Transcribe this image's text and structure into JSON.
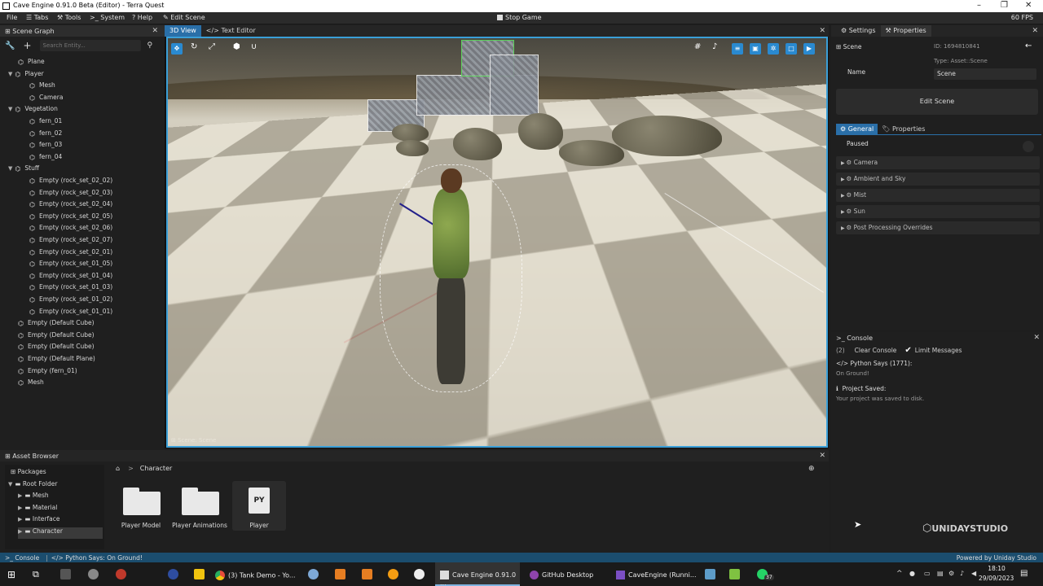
{
  "window": {
    "title": "Cave Engine 0.91.0 Beta (Editor) - Terra Quest",
    "controls": [
      "minimize-icon",
      "maximize-icon",
      "close-icon"
    ]
  },
  "menubar": {
    "items": [
      "File",
      "Tabs",
      "Tools",
      "System",
      "Help"
    ],
    "edit_scene": "Edit Scene",
    "stop_game": "Stop Game",
    "fps": "60 FPS"
  },
  "scene_graph": {
    "title": "Scene Graph",
    "search_placeholder": "Search Entity...",
    "items": [
      {
        "label": "Plane",
        "depth": 1
      },
      {
        "label": "Player",
        "depth": 0
      },
      {
        "label": "Mesh",
        "depth": 2
      },
      {
        "label": "Camera",
        "depth": 2
      },
      {
        "label": "Vegetation",
        "depth": 0
      },
      {
        "label": "fern_01",
        "depth": 2
      },
      {
        "label": "fern_02",
        "depth": 2
      },
      {
        "label": "fern_03",
        "depth": 2
      },
      {
        "label": "fern_04",
        "depth": 2
      },
      {
        "label": "Stuff",
        "depth": 0
      },
      {
        "label": "Empty (rock_set_02_02)",
        "depth": 2
      },
      {
        "label": "Empty (rock_set_02_03)",
        "depth": 2
      },
      {
        "label": "Empty (rock_set_02_04)",
        "depth": 2
      },
      {
        "label": "Empty (rock_set_02_05)",
        "depth": 2
      },
      {
        "label": "Empty (rock_set_02_06)",
        "depth": 2
      },
      {
        "label": "Empty (rock_set_02_07)",
        "depth": 2
      },
      {
        "label": "Empty (rock_set_02_01)",
        "depth": 2
      },
      {
        "label": "Empty (rock_set_01_05)",
        "depth": 2
      },
      {
        "label": "Empty (rock_set_01_04)",
        "depth": 2
      },
      {
        "label": "Empty (rock_set_01_03)",
        "depth": 2
      },
      {
        "label": "Empty (rock_set_01_02)",
        "depth": 2
      },
      {
        "label": "Empty (rock_set_01_01)",
        "depth": 2
      },
      {
        "label": "Empty (Default Cube)",
        "depth": 1
      },
      {
        "label": "Empty (Default Cube)",
        "depth": 1
      },
      {
        "label": "Empty (Default Cube)",
        "depth": 1
      },
      {
        "label": "Empty (Default Plane)",
        "depth": 1
      },
      {
        "label": "Empty (fern_01)",
        "depth": 1
      },
      {
        "label": "Mesh",
        "depth": 1
      }
    ]
  },
  "viewport": {
    "tabs": [
      "3D View",
      "Text Editor"
    ],
    "status": "Scene: Scene"
  },
  "properties": {
    "tabs": [
      "Settings",
      "Properties"
    ],
    "entity_label": "Scene",
    "id": "ID: 1694810841",
    "type": "Type: Asset::Scene",
    "name_label": "Name",
    "name_value": "Scene",
    "edit_button": "Edit Scene",
    "subtabs": [
      "General",
      "Properties"
    ],
    "paused_label": "Paused",
    "sections": [
      "Camera",
      "Ambient and Sky",
      "Mist",
      "Sun",
      "Post Processing Overrides"
    ]
  },
  "console": {
    "title": "Console",
    "count": "(2)",
    "clear": "Clear Console",
    "limit": "Limit Messages",
    "messages": [
      {
        "title": "Python Says (1771):",
        "body": "On Ground!"
      },
      {
        "title": "Project Saved:",
        "body": "Your project was saved to disk."
      }
    ]
  },
  "asset_browser": {
    "title": "Asset Browser",
    "tree": [
      {
        "label": "Packages",
        "depth": 0
      },
      {
        "label": "Root Folder",
        "depth": 0
      },
      {
        "label": "Mesh",
        "depth": 1
      },
      {
        "label": "Material",
        "depth": 1
      },
      {
        "label": "Interface",
        "depth": 1
      },
      {
        "label": "Character",
        "depth": 1
      }
    ],
    "breadcrumb": "Character",
    "assets": [
      {
        "label": "Player Model",
        "kind": "folder"
      },
      {
        "label": "Player Animations",
        "kind": "folder"
      },
      {
        "label": "Player",
        "kind": "python",
        "badge": "PY"
      }
    ]
  },
  "statusbar": {
    "console": "Console",
    "last_message": "Python Says: On Ground!",
    "powered": "Powered by Uniday Studio"
  },
  "watermark": "UNIDAYSTUDIO",
  "taskbar": {
    "apps": [
      "(3) Tank Demo - Yo...",
      "Cave Engine 0.91.0 ...",
      "GitHub Desktop",
      "CaveEngine (Runni..."
    ],
    "notification_count": "37",
    "time": "18:10",
    "date": "29/09/2023"
  }
}
